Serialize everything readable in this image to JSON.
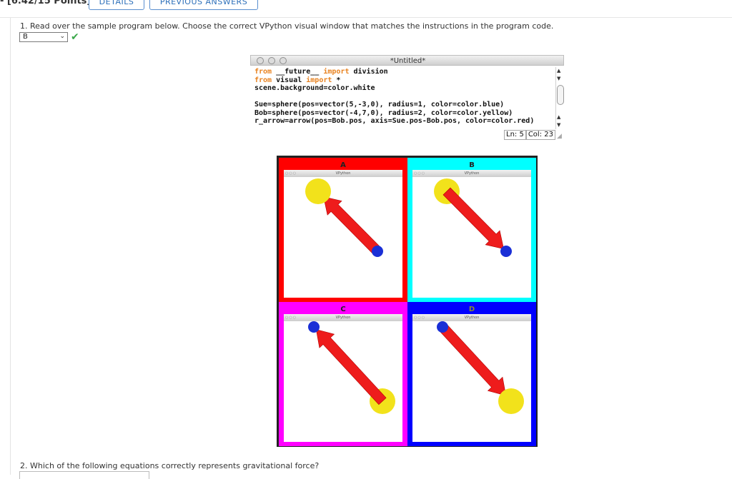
{
  "header": {
    "points": "- [6.42/15 Points]",
    "details_label": "DETAILS",
    "previous_answers_label": "PREVIOUS ANSWERS"
  },
  "question1": {
    "text": "1. Read over the sample program below. Choose the correct VPython visual window that matches the instructions in the program code.",
    "selected_answer": "B",
    "status_icon": "check-icon"
  },
  "editor": {
    "title": "*Untitled*",
    "code_lines": [
      [
        {
          "t": "from",
          "k": true
        },
        {
          "t": " __future__ "
        },
        {
          "t": "import",
          "k": true
        },
        {
          "t": " division"
        }
      ],
      [
        {
          "t": "from",
          "k": true
        },
        {
          "t": " visual "
        },
        {
          "t": "import",
          "k": true
        },
        {
          "t": " *"
        }
      ],
      [
        {
          "t": "scene.background=color.white"
        }
      ],
      [
        {
          "t": ""
        }
      ],
      [
        {
          "t": "Sue=sphere(pos=vector(5,-3,0), radius=1, color=color.blue)"
        }
      ],
      [
        {
          "t": "Bob=sphere(pos=vector(-4,7,0), radius=2, color=color.yellow)"
        }
      ],
      [
        {
          "t": "r_arrow=arrow(pos=Bob.pos, axis=Sue.pos-Bob.pos, color=color.red)"
        }
      ]
    ],
    "status_ln": "Ln: 5",
    "status_col": "Col: 23"
  },
  "options": [
    {
      "letter": "A",
      "window_title": "VPython",
      "border": "#ff0000",
      "arrow_dir": "to-yellow",
      "yellow": "top-left",
      "blue": "bottom-right"
    },
    {
      "letter": "B",
      "window_title": "VPython",
      "border": "#00ffff",
      "arrow_dir": "to-blue",
      "yellow": "top-left",
      "blue": "bottom-right"
    },
    {
      "letter": "C",
      "window_title": "VPython",
      "border": "#ff00ff",
      "arrow_dir": "to-blue",
      "yellow": "bottom-right",
      "blue": "top-left"
    },
    {
      "letter": "D",
      "window_title": "VPython",
      "border": "#0000ff",
      "arrow_dir": "to-yellow",
      "yellow": "bottom-right",
      "blue": "top-left"
    }
  ],
  "question2": {
    "text": "2. Which of the following equations correctly represents gravitational force?"
  }
}
